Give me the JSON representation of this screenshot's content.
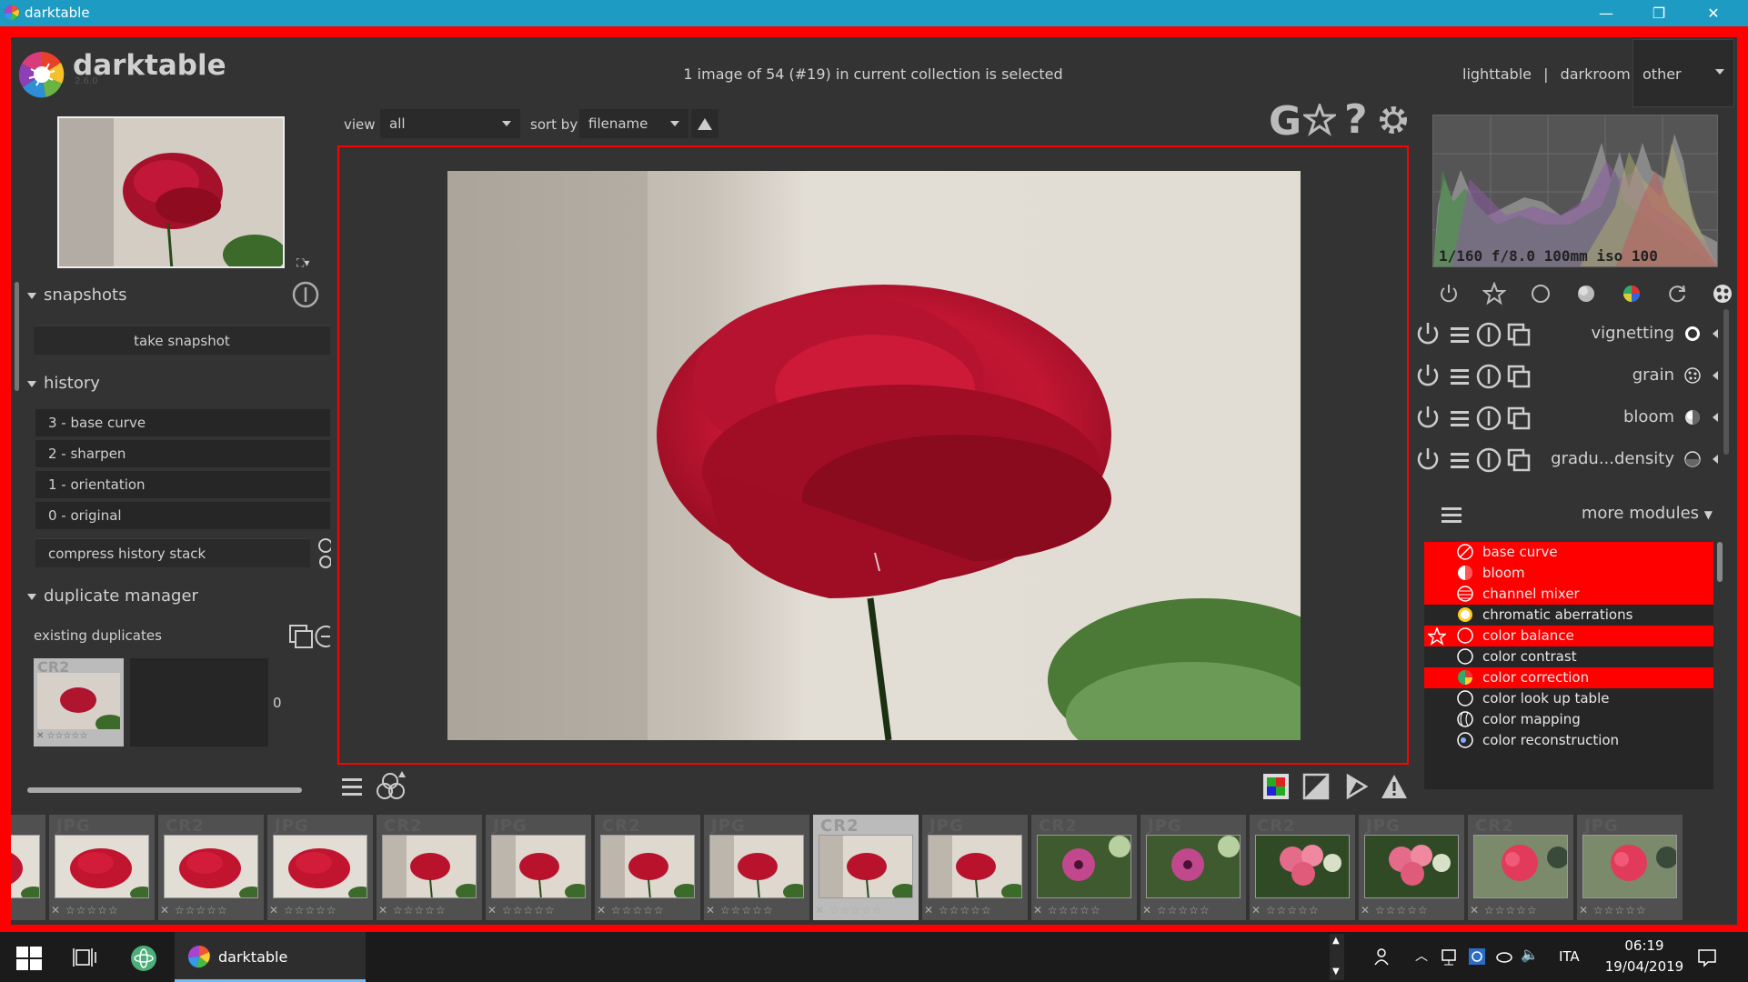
{
  "window": {
    "title": "darktable",
    "minimize": "—",
    "maximize": "❐",
    "close": "✕"
  },
  "header": {
    "app_name": "darktable",
    "version": "2.6.0",
    "status": "1 image of 54 (#19) in current collection is selected",
    "views": {
      "lighttable": "lighttable",
      "sep1": "|",
      "darkroom": "darkroom",
      "sep2": "|"
    },
    "other": "other"
  },
  "left_panel": {
    "snapshots": {
      "title": "snapshots",
      "take_snapshot": "take snapshot"
    },
    "history": {
      "title": "history",
      "items": [
        "3 - base curve",
        "2 - sharpen",
        "1 - orientation",
        "0 - original"
      ],
      "compress": "compress history stack"
    },
    "duplicate_manager": {
      "title": "duplicate manager",
      "existing": "existing duplicates",
      "count": "0",
      "thumb_ext": "CR2",
      "thumb_stars": "✕ ☆☆☆☆☆"
    }
  },
  "toolbar": {
    "view_label": "view",
    "view_value": "all",
    "sort_label": "sort by",
    "sort_value": "filename",
    "g_label": "G"
  },
  "histogram": {
    "info": "1/160 f/8.0 100mm iso 100"
  },
  "modules": {
    "active": [
      {
        "name": "vignetting",
        "icon": "vignette-icon"
      },
      {
        "name": "grain",
        "icon": "grain-icon"
      },
      {
        "name": "bloom",
        "icon": "bloom-icon"
      },
      {
        "name": "gradu...density",
        "icon": "density-icon"
      }
    ],
    "more_label": "more modules",
    "list": [
      {
        "name": "base curve",
        "selected": true,
        "favorite": false
      },
      {
        "name": "bloom",
        "selected": true,
        "favorite": false
      },
      {
        "name": "channel mixer",
        "selected": true,
        "favorite": false
      },
      {
        "name": "chromatic aberrations",
        "selected": false,
        "favorite": false
      },
      {
        "name": "color balance",
        "selected": true,
        "favorite": true
      },
      {
        "name": "color contrast",
        "selected": false,
        "favorite": false
      },
      {
        "name": "color correction",
        "selected": true,
        "favorite": false
      },
      {
        "name": "color look up table",
        "selected": false,
        "favorite": false
      },
      {
        "name": "color mapping",
        "selected": false,
        "favorite": false
      },
      {
        "name": "color reconstruction",
        "selected": false,
        "favorite": false
      }
    ]
  },
  "filmstrip": {
    "stars": "✕ ☆☆☆☆☆",
    "items": [
      {
        "ext": "JPG",
        "subject": "rose",
        "selected": false
      },
      {
        "ext": "CR2",
        "subject": "rose",
        "selected": false
      },
      {
        "ext": "JPG",
        "subject": "rose",
        "selected": false
      },
      {
        "ext": "CR2",
        "subject": "rose-small",
        "selected": false
      },
      {
        "ext": "JPG",
        "subject": "rose-small",
        "selected": false
      },
      {
        "ext": "CR2",
        "subject": "rose-small",
        "selected": false
      },
      {
        "ext": "JPG",
        "subject": "rose-small",
        "selected": false
      },
      {
        "ext": "CR2",
        "subject": "rose-small",
        "selected": true
      },
      {
        "ext": "JPG",
        "subject": "rose-small",
        "selected": false
      },
      {
        "ext": "CR2",
        "subject": "petunia",
        "selected": false
      },
      {
        "ext": "JPG",
        "subject": "petunia",
        "selected": false
      },
      {
        "ext": "CR2",
        "subject": "geranium",
        "selected": false
      },
      {
        "ext": "JPG",
        "subject": "geranium",
        "selected": false
      },
      {
        "ext": "CR2",
        "subject": "geranium2",
        "selected": false
      },
      {
        "ext": "JPG",
        "subject": "geranium2",
        "selected": false
      }
    ]
  },
  "taskbar": {
    "app": "darktable",
    "lang": "ITA",
    "time": "06:19",
    "date": "19/04/2019"
  },
  "colors": {
    "accent": "#ff0000",
    "titlebar": "#1e9bc2",
    "panel": "#333333"
  }
}
